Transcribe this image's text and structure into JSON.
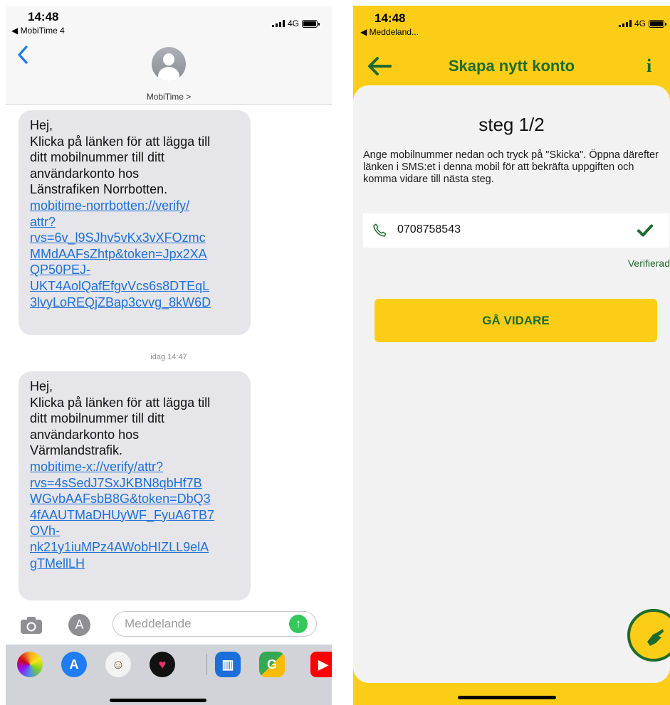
{
  "left_phone": {
    "status_time": "14:48",
    "back_app": "◀ MobiTime 4",
    "network": "4G",
    "contact_name": "MobiTime >",
    "messages": [
      {
        "text_lines": [
          "Hej,",
          "Klicka på länken för att lägga till",
          "ditt mobilnummer till ditt",
          "användarkonto hos",
          "Länstrafiken Norrbotten."
        ],
        "link_lines": [
          "mobitime-norrbotten://verify/",
          "attr?",
          "rvs=6v_l9SJhv5vKx3vXFOzmc",
          "MMdAAFsZhtp&token=Jpx2XA",
          "QP50PEJ-",
          "UKT4AolQafEfgvVcs6s8DTEqL",
          "3lvyLoREQjZBap3cvvg_8kW6D"
        ]
      },
      {
        "text_lines": [
          "Hej,",
          "Klicka på länken för att lägga till",
          "ditt mobilnummer till ditt",
          "användarkonto hos",
          "Värmlandstrafik."
        ],
        "link_lines": [
          "mobitime-x://verify/attr?",
          "rvs=4sSedJ7SxJKBN8qbHf7B",
          "WGvbAAFsbB8G&token=DbQ3",
          "4fAAUTMaDHUyWF_FyuA6TB7",
          "OVh-",
          "nk21y1iuMPz4AWobHIZLL9elA",
          "gTMellLH"
        ]
      }
    ],
    "timestamp": "idag 14:47",
    "input_placeholder": "Meddelande",
    "tray_apps": [
      "photos-icon",
      "appstore-icon",
      "monkey-sticker-icon",
      "heart-sticker-icon",
      "trello-icon",
      "maps-icon",
      "youtube-icon"
    ]
  },
  "right_phone": {
    "status_time": "14:48",
    "back_app": "◀ Meddeland...",
    "network": "4G",
    "title": "Skapa nytt konto",
    "info_label": "i",
    "step_title": "steg 1/2",
    "instructions": "Ange mobilnummer nedan och tryck på \"Skicka\". Öppna därefter länken i SMS:et i denna mobil för att bekräfta uppgiften och komma vidare till nästa steg.",
    "phone_number": "0708758543",
    "verified_label": "Verifierad",
    "continue_button": "GÅ VIDARE",
    "colors": {
      "brand_yellow": "#fccd16",
      "brand_green": "#1e6b2e",
      "link_blue": "#1f6fd6"
    }
  }
}
